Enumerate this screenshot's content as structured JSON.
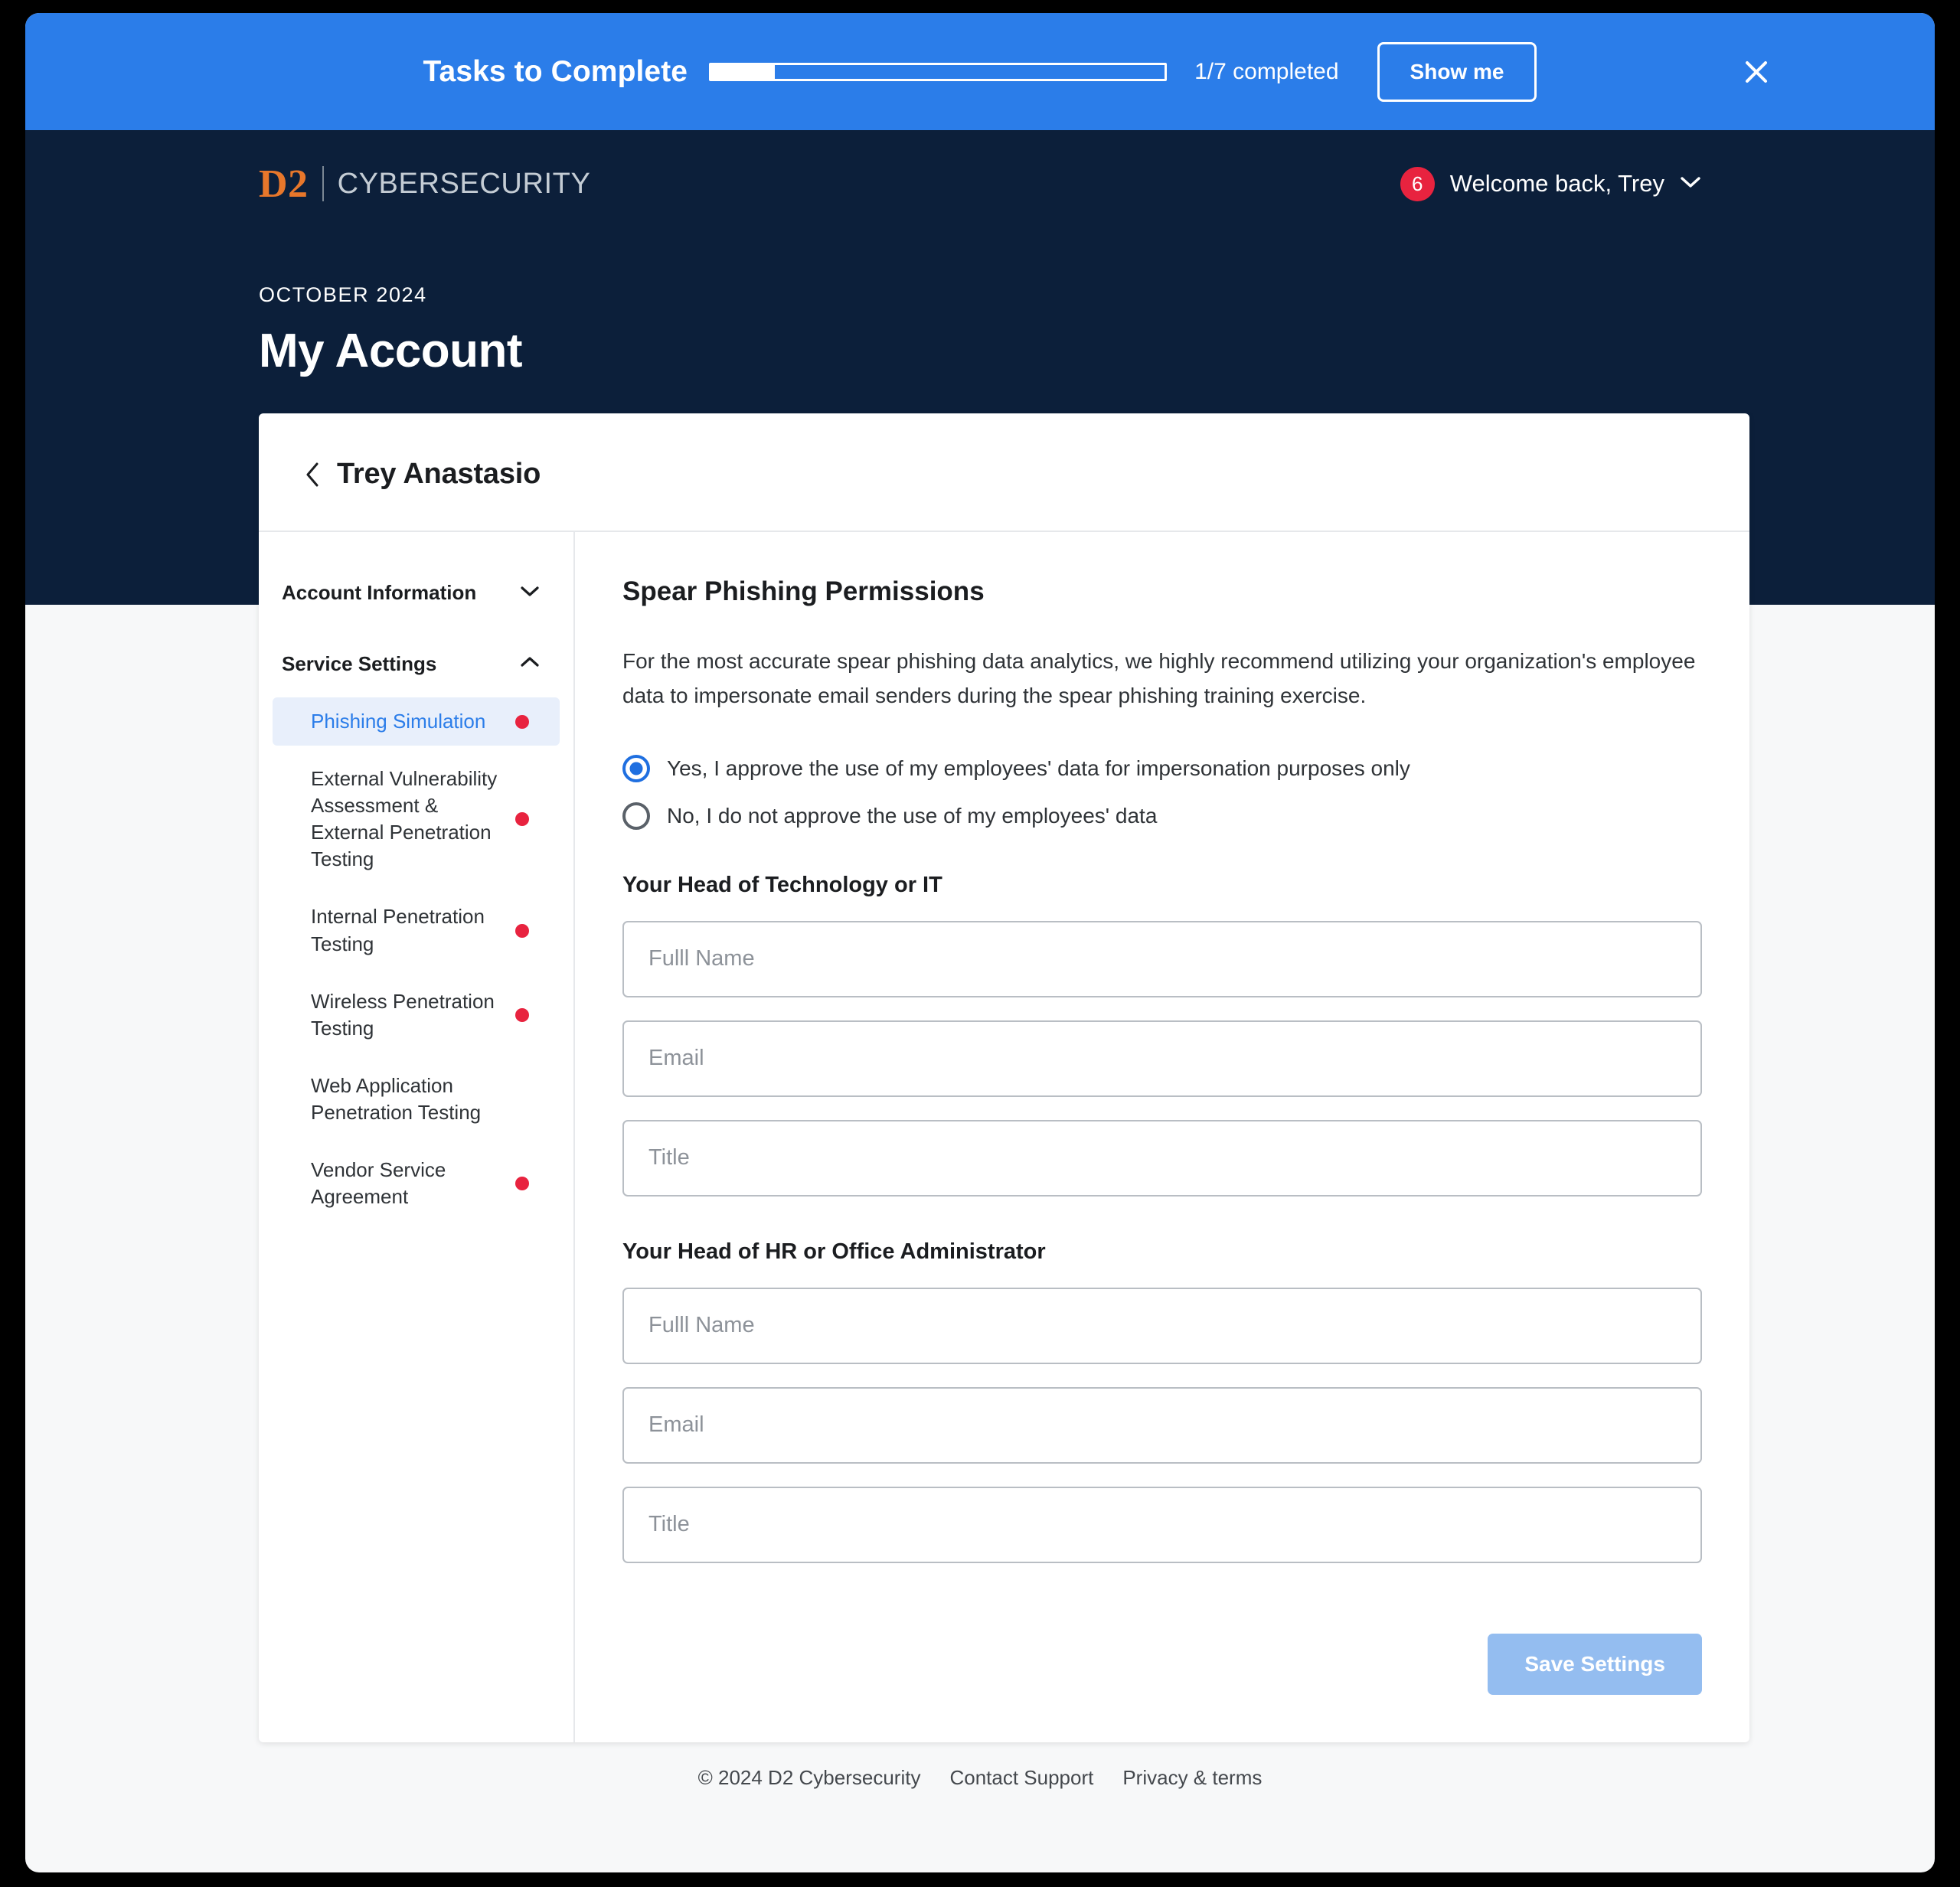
{
  "banner": {
    "title": "Tasks to Complete",
    "progress_label": "1/7 completed",
    "progress_percent": 14,
    "show_me_label": "Show me",
    "close_icon": "close-icon"
  },
  "header": {
    "brand_mark": "D2",
    "brand_name": "CYBERSECURITY",
    "notification_count": "6",
    "welcome_text": "Welcome back, Trey",
    "chevron_icon": "chevron-down-icon"
  },
  "hero": {
    "eyebrow": "OCTOBER 2024",
    "title": "My Account"
  },
  "card": {
    "back_icon": "chevron-left-icon",
    "title": "Trey Anastasio"
  },
  "sidebar": {
    "groups": [
      {
        "label": "Account Information",
        "icon": "chevron-down-icon",
        "expanded": false
      },
      {
        "label": "Service Settings",
        "icon": "chevron-up-icon",
        "expanded": true
      }
    ],
    "items": [
      {
        "label": "Phishing Simulation",
        "active": true,
        "dot": true
      },
      {
        "label": "External Vulnerability Assessment & External Penetration Testing",
        "active": false,
        "dot": true
      },
      {
        "label": "Internal Penetration Testing",
        "active": false,
        "dot": true
      },
      {
        "label": "Wireless Penetration Testing",
        "active": false,
        "dot": true
      },
      {
        "label": "Web Application Penetration Testing",
        "active": false,
        "dot": false
      },
      {
        "label": "Vendor Service Agreement",
        "active": false,
        "dot": true
      }
    ]
  },
  "panel": {
    "title": "Spear Phishing Permissions",
    "description": "For the most accurate spear phishing data analytics, we highly recommend utilizing your organization's employee data to impersonate email senders during the spear phishing training exercise.",
    "radios": [
      {
        "label": "Yes, I approve the use of my employees' data for impersonation purposes only",
        "selected": true
      },
      {
        "label": "No, I do not approve the use of my employees' data",
        "selected": false
      }
    ],
    "sections": [
      {
        "title": "Your Head of Technology or IT",
        "fields": [
          {
            "placeholder": "Fulll Name",
            "value": ""
          },
          {
            "placeholder": "Email",
            "value": ""
          },
          {
            "placeholder": "Title",
            "value": ""
          }
        ]
      },
      {
        "title": "Your Head of HR or Office Administrator",
        "fields": [
          {
            "placeholder": "Fulll Name",
            "value": ""
          },
          {
            "placeholder": "Email",
            "value": ""
          },
          {
            "placeholder": "Title",
            "value": ""
          }
        ]
      }
    ],
    "save_label": "Save Settings"
  },
  "footer": {
    "copyright": "© 2024 D2 Cybersecurity",
    "links": [
      "Contact Support",
      "Privacy & terms"
    ]
  },
  "colors": {
    "banner_blue": "#2b7de9",
    "hero_navy": "#0c1f3a",
    "brand_orange": "#e8772b",
    "accent_blue": "#2b7de9",
    "alert_red": "#e8233f",
    "save_button": "#94bdf0",
    "page_bg": "#f7f8f9"
  }
}
